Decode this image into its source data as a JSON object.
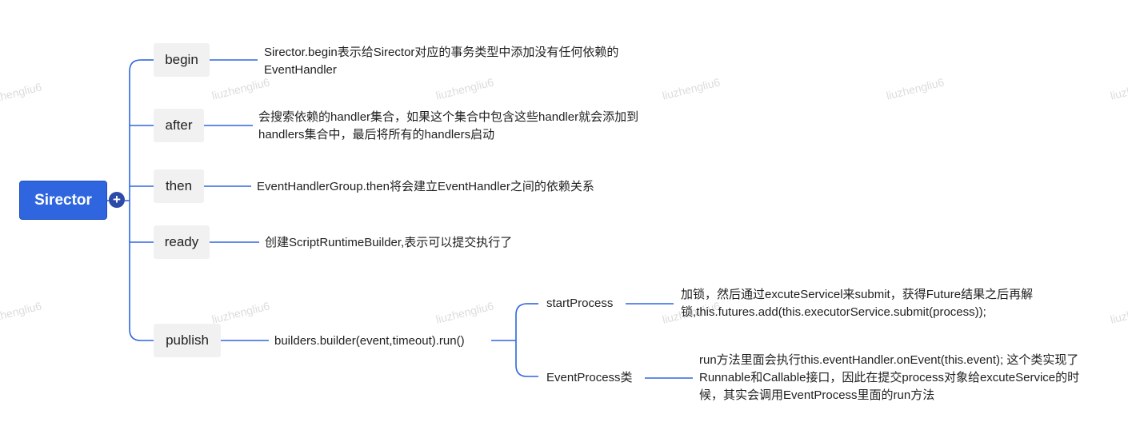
{
  "root": {
    "label": "Sirector"
  },
  "collapse_symbol": "+",
  "branches": [
    {
      "label": "begin",
      "note": "Sirector.begin表示给Sirector对应的事务类型中添加没有任何依赖的EventHandler"
    },
    {
      "label": "after",
      "note": "会搜索依赖的handler集合，如果这个集合中包含这些handler就会添加到handlers集合中，最后将所有的handlers启动"
    },
    {
      "label": "then",
      "note": "EventHandlerGroup.then将会建立EventHandler之间的依赖关系"
    },
    {
      "label": "ready",
      "note": "创建ScriptRuntimeBuilder,表示可以提交执行了"
    },
    {
      "label": "publish",
      "note": "builders.builder(event,timeout).run()",
      "children": [
        {
          "label": "startProcess",
          "note": "加锁，然后通过excuteServicel来submit，获得Future结果之后再解锁,this.futures.add(this.executorService.submit(process));"
        },
        {
          "label": "EventProcess类",
          "note": "run方法里面会执行this.eventHandler.onEvent(this.event); 这个类实现了Runnable和Callable接口，因此在提交process对象给excuteService的时候，其实会调用EventProcess里面的run方法"
        }
      ]
    }
  ],
  "watermark": "liuzhengliu6",
  "colors": {
    "root_bg": "#2f66e0",
    "line": "#2f66e0",
    "branch_bg": "#f1f1f1",
    "collapse_bg": "#2c4aa8"
  }
}
